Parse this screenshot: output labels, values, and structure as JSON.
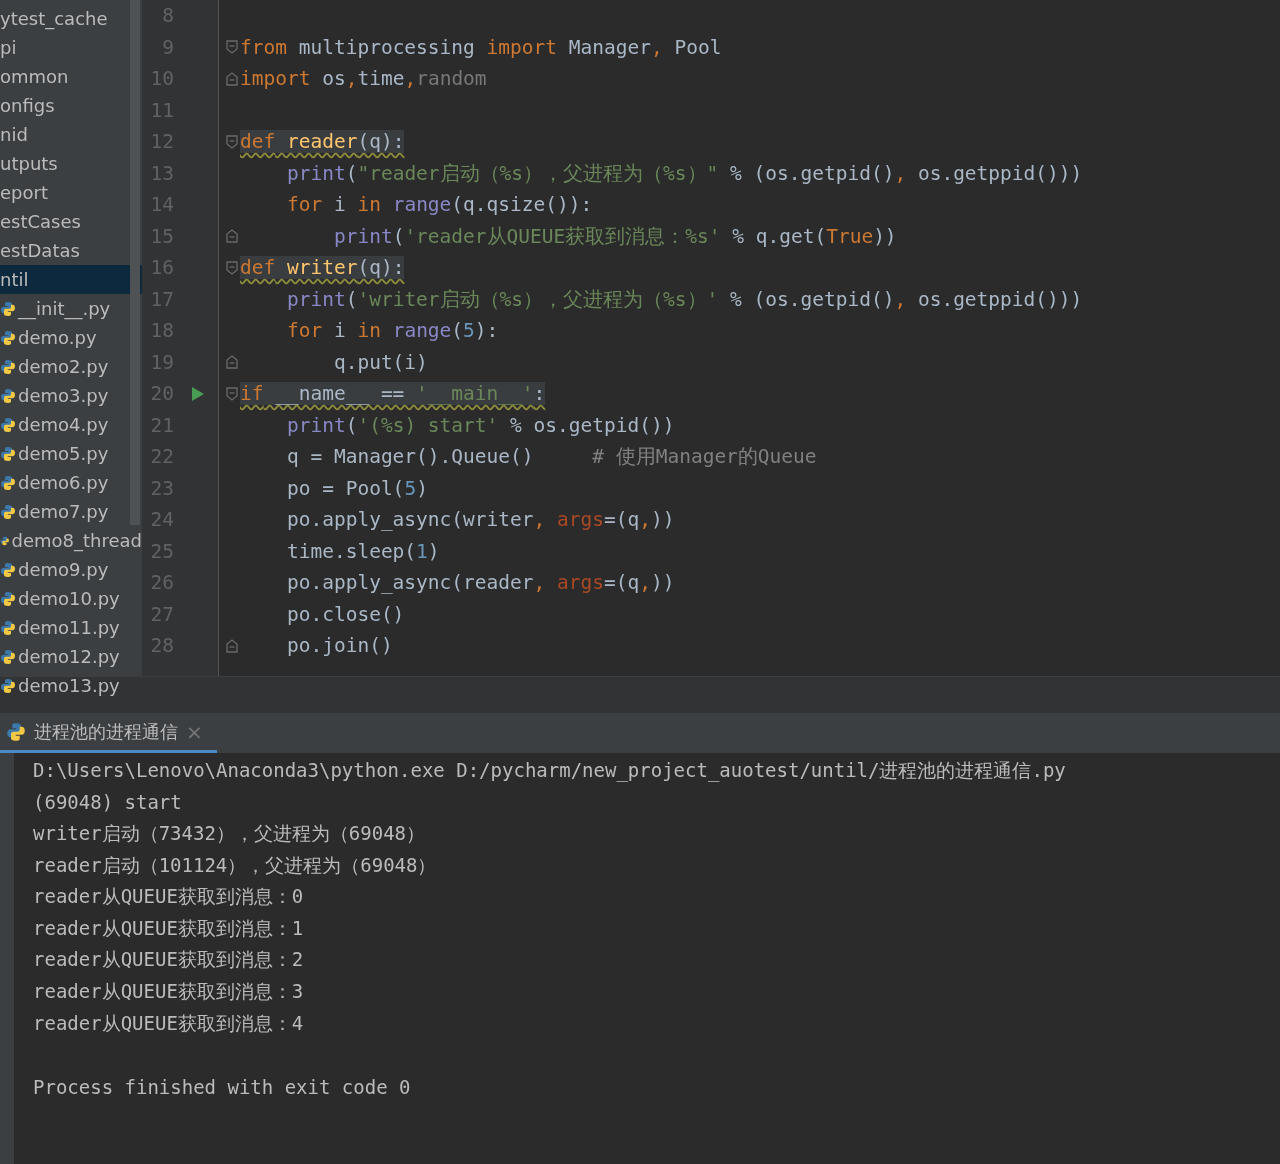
{
  "sidebar": {
    "items": [
      {
        "label": "ytest_cache",
        "kind": "folder",
        "selected": false
      },
      {
        "label": "pi",
        "kind": "folder",
        "selected": false
      },
      {
        "label": "ommon",
        "kind": "folder",
        "selected": false
      },
      {
        "label": "onfigs",
        "kind": "folder",
        "selected": false
      },
      {
        "label": "nid",
        "kind": "folder",
        "selected": false
      },
      {
        "label": "utputs",
        "kind": "folder",
        "selected": false
      },
      {
        "label": "eport",
        "kind": "folder",
        "selected": false
      },
      {
        "label": "estCases",
        "kind": "folder",
        "selected": false
      },
      {
        "label": "estDatas",
        "kind": "folder",
        "selected": false
      },
      {
        "label": "ntil",
        "kind": "folder",
        "selected": true
      },
      {
        "label": "__init__.py",
        "kind": "file",
        "selected": false
      },
      {
        "label": "demo.py",
        "kind": "file",
        "selected": false
      },
      {
        "label": "demo2.py",
        "kind": "file",
        "selected": false
      },
      {
        "label": "demo3.py",
        "kind": "file",
        "selected": false
      },
      {
        "label": "demo4.py",
        "kind": "file",
        "selected": false
      },
      {
        "label": "demo5.py",
        "kind": "file",
        "selected": false
      },
      {
        "label": "demo6.py",
        "kind": "file",
        "selected": false
      },
      {
        "label": "demo7.py",
        "kind": "file",
        "selected": false
      },
      {
        "label": "demo8_thread",
        "kind": "file",
        "selected": false
      },
      {
        "label": "demo9.py",
        "kind": "file",
        "selected": false
      },
      {
        "label": "demo10.py",
        "kind": "file",
        "selected": false
      },
      {
        "label": "demo11.py",
        "kind": "file",
        "selected": false
      },
      {
        "label": "demo12.py",
        "kind": "file",
        "selected": false
      },
      {
        "label": "demo13.py",
        "kind": "file",
        "selected": false
      }
    ]
  },
  "editor": {
    "lines": [
      {
        "number": "8",
        "run": false,
        "fold_start": false,
        "fold_end": false
      },
      {
        "number": "9",
        "highlighted": false,
        "run": false,
        "fold_start": true,
        "fold_end": false,
        "tokens": [
          {
            "t": "from",
            "kind": "keyword"
          },
          {
            "t": " multiprocessing ",
            "kind": "plain"
          },
          {
            "t": "import",
            "kind": "keyword"
          },
          {
            "t": " Manager",
            "kind": "plain"
          },
          {
            "t": ",",
            "kind": "keyword"
          },
          {
            "t": " Pool",
            "kind": "plain"
          }
        ]
      },
      {
        "number": "10",
        "highlighted": false,
        "run": false,
        "fold_start": false,
        "fold_end": true,
        "tokens": [
          {
            "t": "import",
            "kind": "keyword"
          },
          {
            "t": " os",
            "kind": "plain"
          },
          {
            "t": ",",
            "kind": "keyword"
          },
          {
            "t": "time",
            "kind": "plain"
          },
          {
            "t": ",",
            "kind": "keyword"
          },
          {
            "t": "random",
            "kind": "unused"
          }
        ]
      },
      {
        "number": "11",
        "run": false,
        "fold_start": false,
        "fold_end": false
      },
      {
        "number": "12",
        "highlighted": true,
        "run": false,
        "fold_start": true,
        "fold_end": false,
        "tokens": [
          {
            "t": "def",
            "kind": "keyword"
          },
          {
            "t": " reader",
            "kind": "defname"
          },
          {
            "t": "(q):",
            "kind": "plain"
          }
        ]
      },
      {
        "number": "13",
        "highlighted": false,
        "run": false,
        "fold_start": false,
        "fold_end": false,
        "tokens": [
          {
            "t": "    print",
            "kind": "builtin"
          },
          {
            "t": "(",
            "kind": "plain"
          },
          {
            "t": "\"reader启动（%s），父进程为（%s）\"",
            "kind": "string"
          },
          {
            "t": " % (os.getpid()",
            "kind": "plain"
          },
          {
            "t": ",",
            "kind": "keyword"
          },
          {
            "t": " os.getppid()))",
            "kind": "plain"
          }
        ]
      },
      {
        "number": "14",
        "highlighted": false,
        "run": false,
        "fold_start": false,
        "fold_end": false,
        "tokens": [
          {
            "t": "    for",
            "kind": "keyword"
          },
          {
            "t": " i ",
            "kind": "plain"
          },
          {
            "t": "in",
            "kind": "keyword"
          },
          {
            "t": " range",
            "kind": "builtin"
          },
          {
            "t": "(q.qsize()):",
            "kind": "plain"
          }
        ]
      },
      {
        "number": "15",
        "highlighted": false,
        "run": false,
        "fold_start": false,
        "fold_end": true,
        "tokens": [
          {
            "t": "        print",
            "kind": "builtin"
          },
          {
            "t": "(",
            "kind": "plain"
          },
          {
            "t": "'reader从QUEUE获取到消息：%s'",
            "kind": "string"
          },
          {
            "t": " % q.get(",
            "kind": "plain"
          },
          {
            "t": "True",
            "kind": "keyword"
          },
          {
            "t": "))",
            "kind": "plain"
          }
        ]
      },
      {
        "number": "16",
        "highlighted": true,
        "run": false,
        "fold_start": true,
        "fold_end": false,
        "tokens": [
          {
            "t": "def",
            "kind": "keyword"
          },
          {
            "t": " writer",
            "kind": "defname"
          },
          {
            "t": "(q):",
            "kind": "plain"
          }
        ]
      },
      {
        "number": "17",
        "highlighted": false,
        "run": false,
        "fold_start": false,
        "fold_end": false,
        "tokens": [
          {
            "t": "    print",
            "kind": "builtin"
          },
          {
            "t": "(",
            "kind": "plain"
          },
          {
            "t": "'writer启动（%s），父进程为（%s）'",
            "kind": "string"
          },
          {
            "t": " % (os.getpid()",
            "kind": "plain"
          },
          {
            "t": ",",
            "kind": "keyword"
          },
          {
            "t": " os.getppid()))",
            "kind": "plain"
          }
        ]
      },
      {
        "number": "18",
        "highlighted": false,
        "run": false,
        "fold_start": false,
        "fold_end": false,
        "tokens": [
          {
            "t": "    for",
            "kind": "keyword"
          },
          {
            "t": " i ",
            "kind": "plain"
          },
          {
            "t": "in",
            "kind": "keyword"
          },
          {
            "t": " range",
            "kind": "builtin"
          },
          {
            "t": "(",
            "kind": "plain"
          },
          {
            "t": "5",
            "kind": "number"
          },
          {
            "t": "):",
            "kind": "plain"
          }
        ]
      },
      {
        "number": "19",
        "highlighted": false,
        "run": false,
        "fold_start": false,
        "fold_end": true,
        "tokens": [
          {
            "t": "        q.put(i)",
            "kind": "plain"
          }
        ]
      },
      {
        "number": "20",
        "highlighted": true,
        "run": true,
        "fold_start": true,
        "fold_end": false,
        "tokens": [
          {
            "t": "if",
            "kind": "keyword"
          },
          {
            "t": " __name__ == ",
            "kind": "plain"
          },
          {
            "t": "'__main__'",
            "kind": "string"
          },
          {
            "t": ":",
            "kind": "plain"
          }
        ]
      },
      {
        "number": "21",
        "highlighted": false,
        "run": false,
        "fold_start": false,
        "fold_end": false,
        "tokens": [
          {
            "t": "    print",
            "kind": "builtin"
          },
          {
            "t": "(",
            "kind": "plain"
          },
          {
            "t": "'(%s) start'",
            "kind": "string"
          },
          {
            "t": " % os.getpid())",
            "kind": "plain"
          }
        ]
      },
      {
        "number": "22",
        "highlighted": false,
        "run": false,
        "fold_start": false,
        "fold_end": false,
        "tokens": [
          {
            "t": "    q = Manager().Queue()     ",
            "kind": "plain"
          },
          {
            "t": "# 使用Manager的Queue",
            "kind": "comment"
          }
        ]
      },
      {
        "number": "23",
        "highlighted": false,
        "run": false,
        "fold_start": false,
        "fold_end": false,
        "tokens": [
          {
            "t": "    po = Pool(",
            "kind": "plain"
          },
          {
            "t": "5",
            "kind": "number"
          },
          {
            "t": ")",
            "kind": "plain"
          }
        ]
      },
      {
        "number": "24",
        "highlighted": false,
        "run": false,
        "fold_start": false,
        "fold_end": false,
        "tokens": [
          {
            "t": "    po.apply_async(writer",
            "kind": "plain"
          },
          {
            "t": ",",
            "kind": "keyword"
          },
          {
            "t": " args",
            "kind": "param"
          },
          {
            "t": "=(q",
            "kind": "plain"
          },
          {
            "t": ",",
            "kind": "keyword"
          },
          {
            "t": "))",
            "kind": "plain"
          }
        ]
      },
      {
        "number": "25",
        "highlighted": false,
        "run": false,
        "fold_start": false,
        "fold_end": false,
        "tokens": [
          {
            "t": "    time.sleep(",
            "kind": "plain"
          },
          {
            "t": "1",
            "kind": "number"
          },
          {
            "t": ")",
            "kind": "plain"
          }
        ]
      },
      {
        "number": "26",
        "highlighted": false,
        "run": false,
        "fold_start": false,
        "fold_end": false,
        "tokens": [
          {
            "t": "    po.apply_async(reader",
            "kind": "plain"
          },
          {
            "t": ",",
            "kind": "keyword"
          },
          {
            "t": " args",
            "kind": "param"
          },
          {
            "t": "=(q",
            "kind": "plain"
          },
          {
            "t": ",",
            "kind": "keyword"
          },
          {
            "t": "))",
            "kind": "plain"
          }
        ]
      },
      {
        "number": "27",
        "highlighted": false,
        "run": false,
        "fold_start": false,
        "fold_end": false,
        "tokens": [
          {
            "t": "    po.close()",
            "kind": "plain"
          }
        ]
      },
      {
        "number": "28",
        "highlighted": false,
        "run": false,
        "fold_start": false,
        "fold_end": true,
        "tokens": [
          {
            "t": "    po.join()",
            "kind": "plain"
          }
        ]
      }
    ]
  },
  "run_panel": {
    "tab": {
      "label": "进程池的进程通信",
      "selected": true,
      "close": "×"
    },
    "output": [
      "D:\\Users\\Lenovo\\Anaconda3\\python.exe D:/pycharm/new_project_auotest/until/进程池的进程通信.py",
      "(69048) start",
      "writer启动（73432），父进程为（69048）",
      "reader启动（101124），父进程为（69048）",
      "reader从QUEUE获取到消息：0",
      "reader从QUEUE获取到消息：1",
      "reader从QUEUE获取到消息：2",
      "reader从QUEUE获取到消息：3",
      "reader从QUEUE获取到消息：4"
    ],
    "exit_message": "Process finished with exit code 0"
  }
}
